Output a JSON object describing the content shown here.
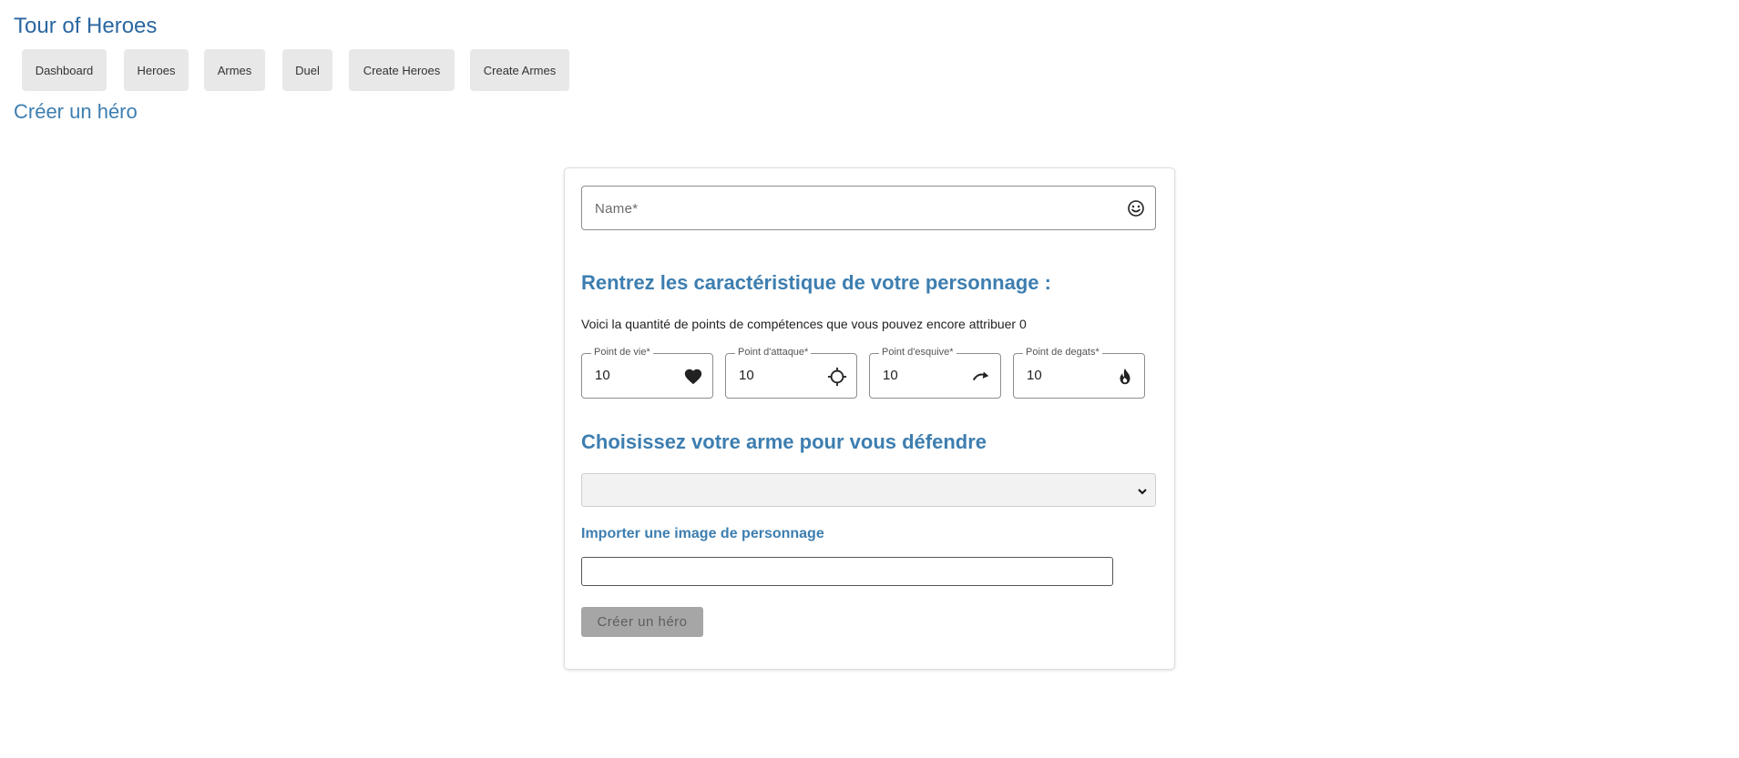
{
  "app": {
    "title": "Tour of Heroes"
  },
  "nav": {
    "items": [
      {
        "label": "Dashboard"
      },
      {
        "label": "Heroes"
      },
      {
        "label": "Armes"
      },
      {
        "label": "Duel"
      },
      {
        "label": "Create Heroes"
      },
      {
        "label": "Create Armes"
      }
    ]
  },
  "page": {
    "heading": "Créer un héro"
  },
  "form": {
    "name_field": {
      "label": "Name*",
      "icon": "smiley-face-icon",
      "value": ""
    },
    "stats_title": "Rentrez les caractéristique de votre personnage :",
    "points_text": "Voici la quantité de points de compétences que vous pouvez encore attribuer 0",
    "stats": [
      {
        "label": "Point de vie*",
        "value": "10",
        "icon": "heart-icon"
      },
      {
        "label": "Point d'attaque*",
        "value": "10",
        "icon": "crosshair-icon"
      },
      {
        "label": "Point d'esquive*",
        "value": "10",
        "icon": "redo-arrow-icon"
      },
      {
        "label": "Point de degats*",
        "value": "10",
        "icon": "flame-icon"
      }
    ],
    "weapon_title": "Choisissez votre arme pour vous défendre",
    "weapon_select": {
      "selected": "",
      "icon": "chevron-down-icon"
    },
    "image_label": "Importer une image de personnage",
    "submit_label": "Créer un héro"
  },
  "colors": {
    "title_blue": "#2b67a1",
    "heading_blue": "#3d7eb0",
    "nav_button_bg": "#e8e8e8",
    "disabled_button_bg": "#a6a6a6"
  }
}
